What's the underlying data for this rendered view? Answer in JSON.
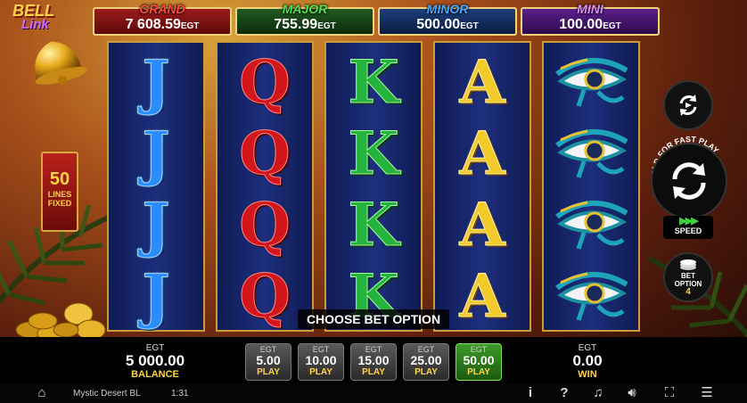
{
  "logo": {
    "line1": "BELL",
    "line2": "Link"
  },
  "jackpots": {
    "grand": {
      "name": "GRAND",
      "amount": "7 608.59",
      "currency": "EGT"
    },
    "major": {
      "name": "MAJOR",
      "amount": "755.99",
      "currency": "EGT"
    },
    "minor": {
      "name": "MINOR",
      "amount": "500.00",
      "currency": "EGT"
    },
    "mini": {
      "name": "MINI",
      "amount": "100.00",
      "currency": "EGT"
    }
  },
  "lines_fixed": {
    "number": "50",
    "line1": "LINES",
    "line2": "FIXED"
  },
  "reels": [
    [
      "J",
      "J",
      "J",
      "J"
    ],
    [
      "Q",
      "Q",
      "Q",
      "Q"
    ],
    [
      "K",
      "K",
      "K",
      "K"
    ],
    [
      "A",
      "A",
      "A",
      "A"
    ],
    [
      "eye-of-horus",
      "eye-of-horus",
      "eye-of-horus",
      "eye-of-horus"
    ]
  ],
  "choose_bet_text": "CHOOSE BET OPTION",
  "controls": {
    "hold_text": "HOLD FOR FAST PLAY",
    "speed_label": "SPEED",
    "bet_option_label1": "BET",
    "bet_option_label2": "OPTION",
    "bet_option_value": "4"
  },
  "balance": {
    "currency": "EGT",
    "value": "5 000.00",
    "label": "BALANCE"
  },
  "win": {
    "currency": "EGT",
    "value": "0.00",
    "label": "WIN"
  },
  "bets": [
    {
      "currency": "EGT",
      "value": "5.00",
      "label": "PLAY",
      "active": false
    },
    {
      "currency": "EGT",
      "value": "10.00",
      "label": "PLAY",
      "active": false
    },
    {
      "currency": "EGT",
      "value": "15.00",
      "label": "PLAY",
      "active": false
    },
    {
      "currency": "EGT",
      "value": "25.00",
      "label": "PLAY",
      "active": false
    },
    {
      "currency": "EGT",
      "value": "50.00",
      "label": "PLAY",
      "active": true
    }
  ],
  "footer": {
    "game_name": "Mystic Desert BL",
    "clock": "1:31"
  },
  "footer_icons": [
    "home-icon",
    "info-icon",
    "help-icon",
    "music-icon",
    "volume-icon",
    "fullscreen-icon",
    "menu-icon"
  ]
}
